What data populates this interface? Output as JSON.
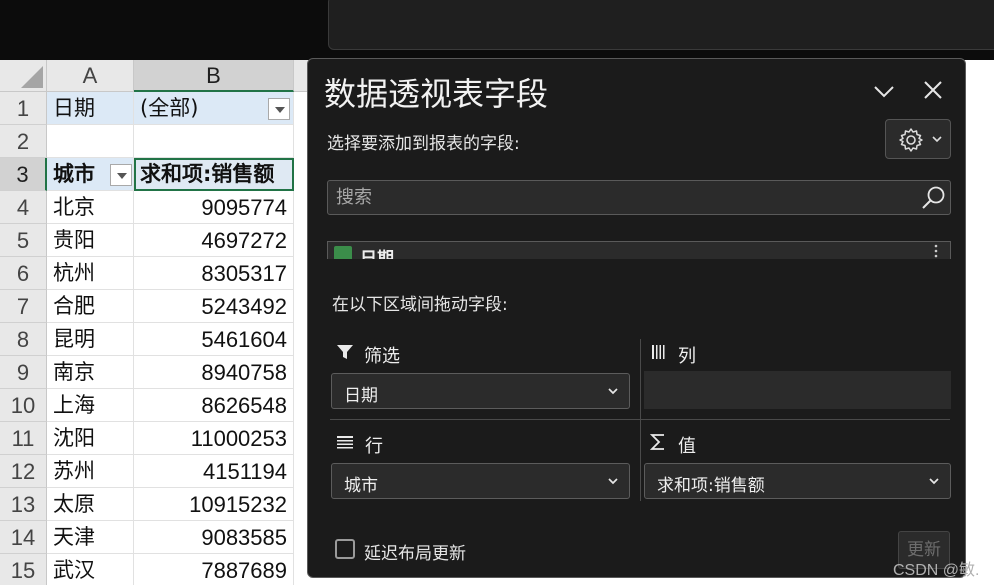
{
  "spreadsheet": {
    "columns": [
      "A",
      "B"
    ],
    "row_numbers": [
      "1",
      "2",
      "3",
      "4",
      "5",
      "6",
      "7",
      "8",
      "9",
      "10",
      "11",
      "12",
      "13",
      "14",
      "15"
    ],
    "filter_row": {
      "label": "日期",
      "value": "(全部)"
    },
    "header_row": {
      "city": "城市",
      "value": "求和项:销售额"
    },
    "data_rows": [
      {
        "city": "北京",
        "value": "9095774"
      },
      {
        "city": "贵阳",
        "value": "4697272"
      },
      {
        "city": "杭州",
        "value": "8305317"
      },
      {
        "city": "合肥",
        "value": "5243492"
      },
      {
        "city": "昆明",
        "value": "5461604"
      },
      {
        "city": "南京",
        "value": "8940758"
      },
      {
        "city": "上海",
        "value": "8626548"
      },
      {
        "city": "沈阳",
        "value": "11000253"
      },
      {
        "city": "苏州",
        "value": "4151194"
      },
      {
        "city": "太原",
        "value": "10915232"
      },
      {
        "city": "天津",
        "value": "9083585"
      },
      {
        "city": "武汉",
        "value": "7887689"
      }
    ]
  },
  "pivot_panel": {
    "title": "数据透视表字段",
    "choose_fields_label": "选择要添加到报表的字段:",
    "search_placeholder": "搜索",
    "field_items": [
      {
        "label": "日期",
        "checked": true
      }
    ],
    "drag_label": "在以下区域间拖动字段:",
    "areas": {
      "filters": {
        "label": "筛选",
        "icon": "filter-icon",
        "value": "日期"
      },
      "columns": {
        "label": "列",
        "icon": "columns-icon"
      },
      "rows": {
        "label": "行",
        "icon": "rows-icon",
        "value": "城市"
      },
      "values": {
        "label": "值",
        "icon": "sigma-icon",
        "value": "求和项:销售额"
      }
    },
    "defer_label": "延迟布局更新",
    "update_label": "更新"
  },
  "watermark": "CSDN @敏.",
  "colors": {
    "panel_bg": "#1b1b1b",
    "accent_green": "#217346",
    "pivot_header_blue": "#dce9f6"
  }
}
